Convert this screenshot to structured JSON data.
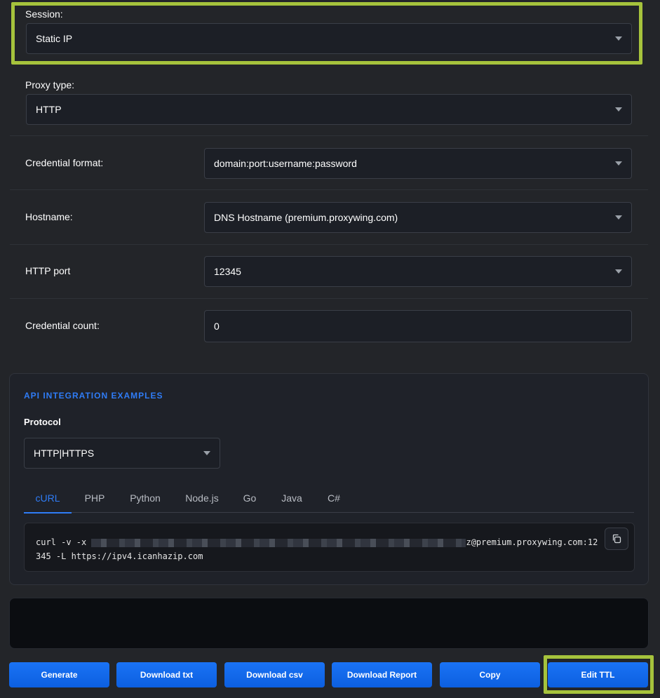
{
  "form": {
    "session": {
      "label": "Session:",
      "value": "Static IP"
    },
    "proxy_type": {
      "label": "Proxy type:",
      "value": "HTTP"
    },
    "credential_format": {
      "label": "Credential format:",
      "value": "domain:port:username:password"
    },
    "hostname": {
      "label": "Hostname:",
      "value": "DNS Hostname (premium.proxywing.com)"
    },
    "http_port": {
      "label": "HTTP port",
      "value": "12345"
    },
    "credential_count": {
      "label": "Credential count:",
      "value": "0"
    }
  },
  "api": {
    "title": "API INTEGRATION EXAMPLES",
    "protocol_label": "Protocol",
    "protocol_value": "HTTP|HTTPS",
    "tabs": [
      "cURL",
      "PHP",
      "Python",
      "Node.js",
      "Go",
      "Java",
      "C#"
    ],
    "active_tab": "cURL",
    "code_prefix": "curl -v -x ",
    "code_suffix": "z@premium.proxywing.com:12",
    "code_line2": "345 -L https://ipv4.icanhazip.com"
  },
  "actions": {
    "generate": "Generate",
    "download_txt": "Download txt",
    "download_csv": "Download csv",
    "download_report": "Download Report",
    "copy": "Copy",
    "edit_ttl": "Edit TTL"
  },
  "colors": {
    "accent": "#2f7cf6",
    "highlight": "#a6c33c",
    "background": "#232529"
  },
  "icons": {
    "dropdown": "chevron-down-icon",
    "copy": "copy-icon"
  }
}
